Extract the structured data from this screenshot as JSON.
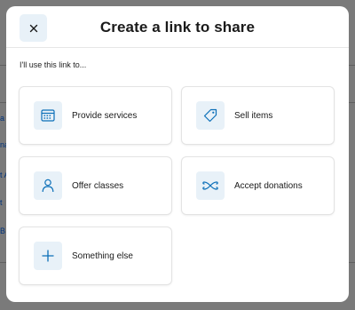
{
  "modal": {
    "title": "Create a link to share",
    "intro": "I'll use this link to...",
    "close_icon": "close-icon"
  },
  "options": [
    {
      "label": "Provide services",
      "icon": "calendar-icon"
    },
    {
      "label": "Sell items",
      "icon": "tag-icon"
    },
    {
      "label": "Offer classes",
      "icon": "person-icon"
    },
    {
      "label": "Accept donations",
      "icon": "ribbon-icon"
    },
    {
      "label": "Something else",
      "icon": "plus-icon"
    }
  ],
  "background": {
    "partial_links": [
      "a",
      "na",
      "t A",
      "t",
      "B"
    ]
  },
  "colors": {
    "accent": "#0b6fb8",
    "icon_bg": "#e8f1f8",
    "scrim": "#7a7a7a"
  }
}
